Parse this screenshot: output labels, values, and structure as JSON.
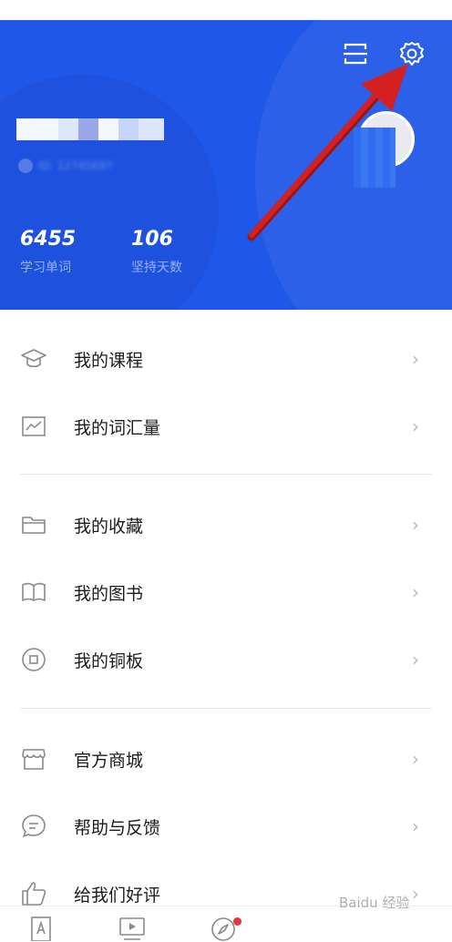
{
  "header": {
    "user_id_text": "ID: 12745697",
    "stats": [
      {
        "value": "6455",
        "label": "学习单词"
      },
      {
        "value": "106",
        "label": "坚持天数"
      }
    ]
  },
  "menu": {
    "items": [
      {
        "label": "我的课程",
        "icon": "graduation-cap-icon"
      },
      {
        "label": "我的词汇量",
        "icon": "chart-icon"
      },
      {
        "label": "我的收藏",
        "icon": "folder-icon"
      },
      {
        "label": "我的图书",
        "icon": "book-icon"
      },
      {
        "label": "我的铜板",
        "icon": "coin-icon"
      },
      {
        "label": "官方商城",
        "icon": "store-icon"
      },
      {
        "label": "帮助与反馈",
        "icon": "chat-icon"
      },
      {
        "label": "给我们好评",
        "icon": "thumbs-up-icon"
      }
    ],
    "chevron": "›"
  },
  "tabbar": {
    "tabs": [
      {
        "icon": "dictionary-icon"
      },
      {
        "icon": "video-icon"
      },
      {
        "icon": "compass-icon",
        "badge": true
      }
    ]
  },
  "watermark": "Baidu 经验",
  "colors": {
    "header_bg": "#1f57e8",
    "arrow": "#d42020",
    "badge": "#e8333a"
  }
}
